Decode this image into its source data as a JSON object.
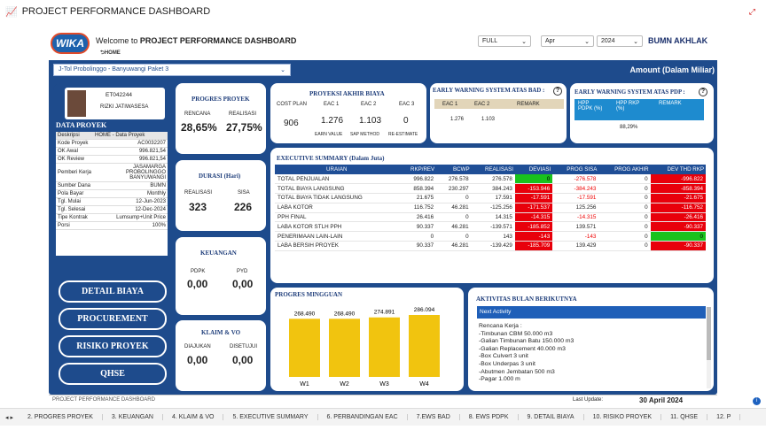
{
  "window_title": "PROJECT PERFORMANCE DASHBOARD",
  "header": {
    "logo": "WIKA",
    "welcome_prefix": "Welcome to ",
    "welcome_title": "PROJECT PERFORMANCE DASHBOARD",
    "home": "HOME",
    "filter_mode": "FULL",
    "filter_month": "Apr",
    "filter_year": "2024",
    "bumn": "BUMN",
    "akhlak": "AKHLAK"
  },
  "project": {
    "name": "J-Tol Probolinggo - Banyuwangi Paket 3",
    "amount_label": "Amount (Dalam Miliar)"
  },
  "user": {
    "id": "ET042244",
    "name": "RIZKI JATIWASESA"
  },
  "data_proyek": {
    "title": "DATA PROYEK",
    "head": [
      "Deskripsi",
      "HOME - Data Proyek"
    ],
    "rows": [
      [
        "Kode Proyek",
        "AC0032207"
      ],
      [
        "OK Awal",
        "996.821,54"
      ],
      [
        "OK Review",
        "996.821,54"
      ],
      [
        "Pemberi Kerja",
        "JASAMARGA PROBOLINGGO BANYUWANGI"
      ],
      [
        "Sumber Dana",
        "BUMN"
      ],
      [
        "Pola Bayar",
        "Monthly"
      ],
      [
        "Tgl. Mulai",
        "12-Jun-2023"
      ],
      [
        "Tgl. Selesai",
        "12-Dec-2024"
      ],
      [
        "Tipe Kontrak",
        "Lumsump+Unit Price"
      ],
      [
        "Porsi",
        "100%"
      ]
    ]
  },
  "nav": {
    "detail": "DETAIL BIAYA",
    "procurement": "PROCUREMENT",
    "risiko": "RISIKO PROYEK",
    "qhse": "QHSE"
  },
  "progres": {
    "title": "PROGRES PROYEK",
    "rencana_label": "RENCANA",
    "realisasi_label": "REALISASI",
    "rencana": "28,65%",
    "realisasi": "27,75%"
  },
  "durasi": {
    "title": "DURASI (Hari)",
    "realisasi_label": "REALISASI",
    "sisa_label": "SISA",
    "realisasi": "323",
    "sisa": "226"
  },
  "keuangan": {
    "title": "KEUANGAN",
    "pdpk_label": "PDPK",
    "pyd_label": "PYD",
    "pdpk": "0,00",
    "pyd": "0,00"
  },
  "klaim": {
    "title": "KLAIM & VO",
    "diajukan_label": "DIAJUKAN",
    "disetujui_label": "DISETUJUI",
    "diajukan": "0,00",
    "disetujui": "0,00"
  },
  "proyeksi": {
    "title": "PROYEKSI AKHIR BIAYA",
    "cost_plan_label": "COST PLAN",
    "cost_plan": "906",
    "eac1_label": "EAC 1",
    "eac2_label": "EAC 2",
    "eac3_label": "EAC 3",
    "eac1": "1.276",
    "eac2": "1.103",
    "eac3": "0",
    "eac1_sub": "EARN VALUE",
    "eac2_sub": "SAP METHOD",
    "eac3_sub": "RE-ESTIMATE"
  },
  "ews_bad": {
    "title": "EARLY WARNING SYSTEM ATAS BAD :",
    "cols": [
      "EAC 1",
      "EAC 2",
      "REMARK"
    ],
    "eac1": "1.276",
    "eac2": "1.103"
  },
  "ews_pdp": {
    "title": "EARLY WARNING SYSTEM ATAS PDP :",
    "cols": [
      "HPP PDPK (%)",
      "HPP RKP (%)",
      "REMARK"
    ],
    "hpp_rkp": "88,29%"
  },
  "exec": {
    "title": "EXECUTIVE SUMMARY (Dalam Juta)",
    "cols": [
      "URAIAN",
      "RKP/REV",
      "BCWP",
      "REALISASI",
      "DEVIASI",
      "PROG SISA",
      "PROG AKHIR",
      "DEV THD RKP"
    ],
    "rows": [
      [
        "TOTAL PENJUALAN",
        "996.822",
        "276.578",
        "276.578",
        "0",
        "-276.578",
        "0",
        "-996.822"
      ],
      [
        "TOTAL BIAYA LANGSUNG",
        "858.394",
        "230.297",
        "384.243",
        "-153.946",
        "-384.243",
        "0",
        "-858.394"
      ],
      [
        "TOTAL BIAYA TIDAK LANGSUNG",
        "21.675",
        "0",
        "17.591",
        "-17.591",
        "-17.591",
        "0",
        "-21.675"
      ],
      [
        "LABA KOTOR",
        "116.752",
        "46.281",
        "-125.256",
        "-171.537",
        "125.256",
        "0",
        "-116.752"
      ],
      [
        "PPH FINAL",
        "26.416",
        "0",
        "14.315",
        "-14.315",
        "-14.315",
        "0",
        "-26.416"
      ],
      [
        "LABA KOTOR STLH PPH",
        "90.337",
        "46.281",
        "-139.571",
        "-185.852",
        "139.571",
        "0",
        "-90.337"
      ],
      [
        "PENERIMAAN LAIN-LAIN",
        "0",
        "0",
        "143",
        "-143",
        "-143",
        "0",
        "0"
      ],
      [
        "LABA BERSIH PROYEK",
        "90.337",
        "46.281",
        "-139.429",
        "-185.709",
        "139.429",
        "0",
        "-90.337"
      ]
    ],
    "deviasi_colors": [
      "green",
      "red",
      "red",
      "red",
      "red",
      "red",
      "red",
      "red"
    ],
    "prog_sisa_colors": [
      "neg",
      "neg",
      "neg",
      "none",
      "neg",
      "none",
      "neg",
      "none"
    ],
    "dev_rkp_colors": [
      "red",
      "red",
      "red",
      "red",
      "red",
      "red",
      "green",
      "red"
    ]
  },
  "mingguan": {
    "title": "PROGRES MINGGUAN"
  },
  "chart_data": {
    "type": "bar",
    "categories": [
      "W1",
      "W2",
      "W3",
      "W4"
    ],
    "values": [
      268.49,
      268.49,
      274.891,
      286.094
    ],
    "labels": [
      "268.490",
      "268.490",
      "274.891",
      "286.094"
    ],
    "color": "#f1c40f"
  },
  "aktivitas": {
    "title": "AKTIVITAS BULAN BERIKUTNYA",
    "header": "Next Activity",
    "lines": [
      "Rencana Kerja :",
      "-Timbunan CBM 50.000 m3",
      "-Galian Timbunan Batu 150.000 m3",
      "-Galian Replacement 40.000 m3",
      "-Box Culvert 3 unit",
      "-Box Underpas 3 unit",
      "-Abutmen Jembatan 500 m3",
      "-Pagar 1.000 m"
    ]
  },
  "footer": {
    "label": "PROJECT PERFORMANCE DASHBOARD",
    "last_update_label": "Last Update:",
    "last_update": "30 April 2024"
  },
  "tabs": [
    "2. PROGRES PROYEK",
    "3. KEUANGAN",
    "4. KLAIM & VO",
    "5. EXECUTIVE SUMMARY",
    "6. PERBANDINGAN EAC",
    "7.EWS BAD",
    "8. EWS PDPK",
    "9. DETAIL BIAYA",
    "10. RISIKO PROYEK",
    "11. QHSE",
    "12. P"
  ]
}
